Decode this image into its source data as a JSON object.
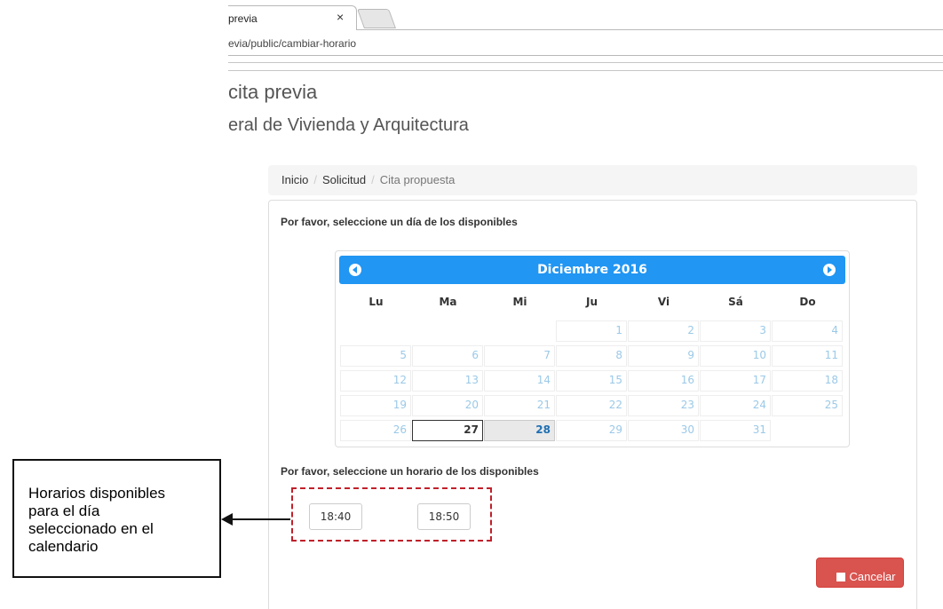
{
  "browser": {
    "tab_title": "previa",
    "tab_close": "×",
    "url": "evia/public/cambiar-horario"
  },
  "header": {
    "title": "cita previa",
    "subtitle": "eral de Vivienda y Arquitectura"
  },
  "breadcrumb": {
    "items": [
      "Inicio",
      "Solicitud",
      "Cita propuesta"
    ],
    "separator": "/"
  },
  "calendar": {
    "prompt": "Por favor, seleccione un día de los disponibles",
    "month_label": "Diciembre 2016",
    "weekdays": [
      "Lu",
      "Ma",
      "Mi",
      "Ju",
      "Vi",
      "Sá",
      "Do"
    ],
    "weeks": [
      [
        "",
        "",
        "",
        "1",
        "2",
        "3",
        "4"
      ],
      [
        "5",
        "6",
        "7",
        "8",
        "9",
        "10",
        "11"
      ],
      [
        "12",
        "13",
        "14",
        "15",
        "16",
        "17",
        "18"
      ],
      [
        "19",
        "20",
        "21",
        "22",
        "23",
        "24",
        "25"
      ],
      [
        "26",
        "27",
        "28",
        "29",
        "30",
        "31",
        ""
      ]
    ],
    "selected_day": "27",
    "available_day": "28",
    "colors": {
      "header": "#2196f3",
      "disabled_text": "#9bc9e8",
      "available_text": "#1f6fb2"
    }
  },
  "timeslots": {
    "prompt": "Por favor, seleccione un horario de los disponibles",
    "slots": [
      "18:40",
      "18:50"
    ]
  },
  "annotation": {
    "lines": [
      "Horarios disponibles",
      "para el día",
      "seleccionado en el",
      "calendario"
    ]
  },
  "actions": {
    "cancel_label": "Cancelar",
    "cancel_color": "#d9534f"
  }
}
